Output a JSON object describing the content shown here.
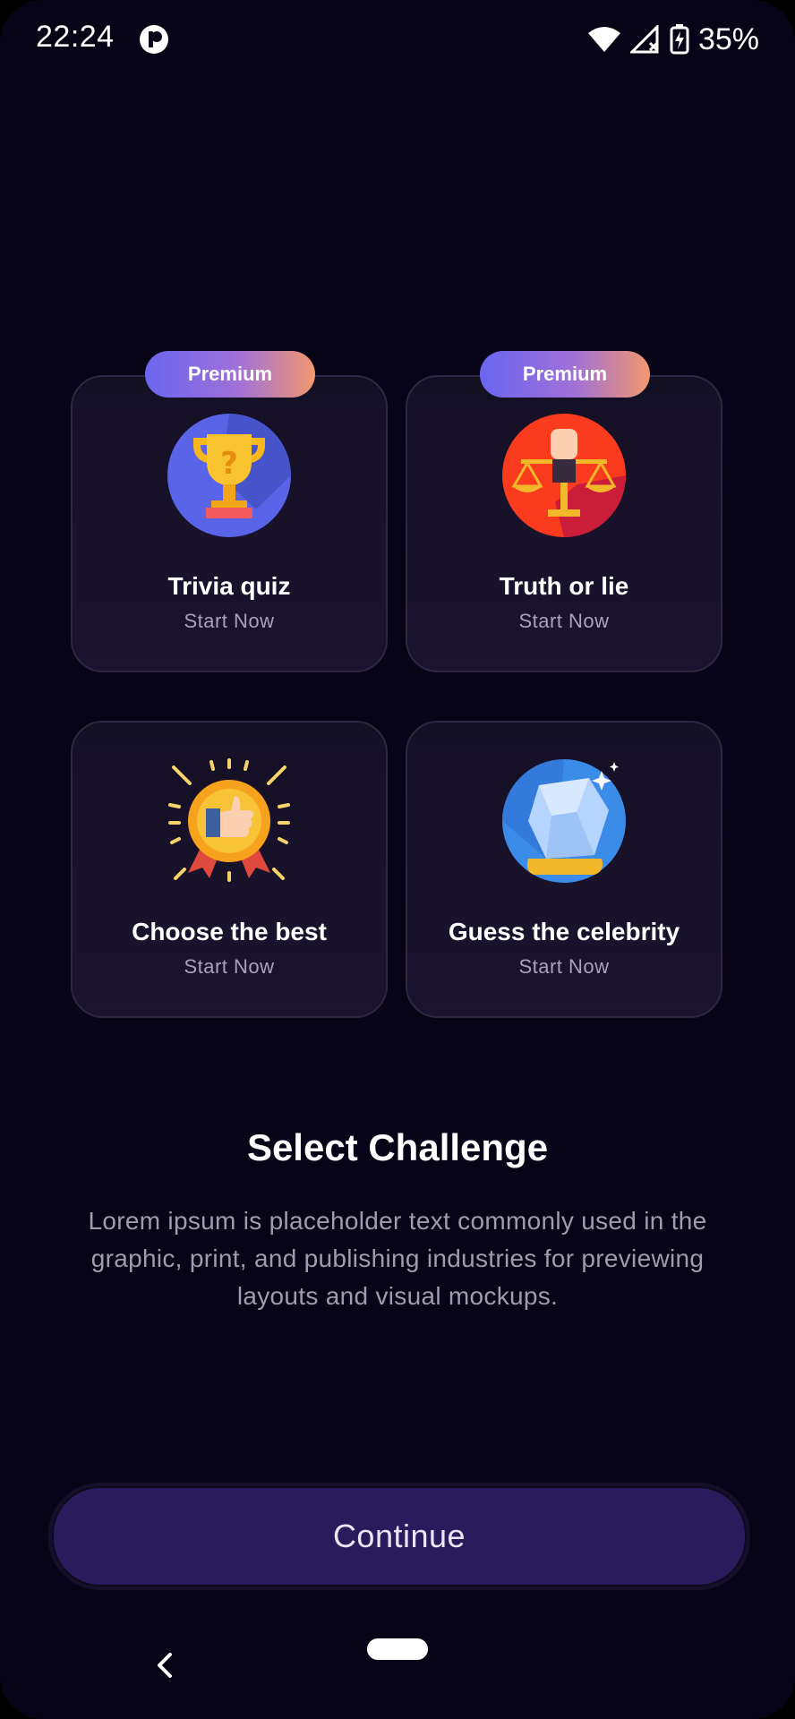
{
  "status_bar": {
    "time": "22:24",
    "battery": "35%",
    "icons": [
      "app-indicator-icon",
      "wifi-icon",
      "signal-icon",
      "battery-charging-icon"
    ]
  },
  "cards": [
    {
      "title": "Trivia quiz",
      "subtitle": "Start Now",
      "badge": "Premium",
      "icon": "trophy-icon"
    },
    {
      "title": "Truth or lie",
      "subtitle": "Start Now",
      "badge": "Premium",
      "icon": "scales-icon"
    },
    {
      "title": "Choose the best",
      "subtitle": "Start Now",
      "icon": "award-medal-icon"
    },
    {
      "title": "Guess the celebrity",
      "subtitle": "Start Now",
      "icon": "crystal-icon"
    }
  ],
  "heading": "Select Challenge",
  "description": "Lorem ipsum is placeholder text commonly used in the graphic, print, and publishing industries for previewing layouts and visual mockups.",
  "continue_label": "Continue",
  "colors": {
    "background": "#080418",
    "card": "#141024",
    "button": "#2a1c5c",
    "badge_start": "#6a66f0",
    "badge_end": "#f2976e"
  }
}
